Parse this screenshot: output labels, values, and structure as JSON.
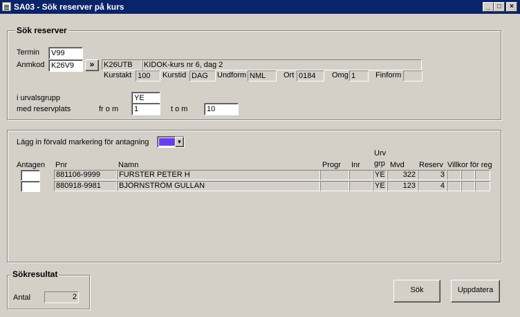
{
  "window": {
    "title": "SA03 - Sök reserver på kurs"
  },
  "search_group": {
    "title": "Sök reserver",
    "termin_label": "Termin",
    "termin_value": "V99",
    "anmkod_label": "Anmkod",
    "anmkod_value": "K26V9",
    "lookup_button": "»",
    "course_code": "K26UTB",
    "course_name": "KIDOK-kurs nr 6, dag 2",
    "kurstakt_label": "Kurstakt",
    "kurstakt_value": "100",
    "kurstid_label": "Kurstid",
    "kurstid_value": "DAG",
    "undform_label": "Undform",
    "undform_value": "NML",
    "ort_label": "Ort",
    "ort_value": "0184",
    "omg_label": "Omg",
    "omg_value": "1",
    "finform_label": "Finform",
    "finform_value": "",
    "urvalsgrupp_label": "i urvalsgrupp",
    "urvalsgrupp_value": "YE",
    "reservplats_label": "med reservplats",
    "from_label": "fr o m",
    "from_value": "1",
    "tom_label": "t o m",
    "tom_value": "10"
  },
  "list_group": {
    "marking_label": "Lägg in förvald markering för antagning",
    "marking_color": "#6a3ef0",
    "headers": {
      "antagen": "Antagen",
      "pnr": "Pnr",
      "namn": "Namn",
      "progr": "Progr",
      "inr": "Inr",
      "urv_top": "Urv",
      "urv_bottom": "grp",
      "mvd": "Mvd",
      "reserv": "Reserv",
      "villkor": "Villkor för reg"
    },
    "rows": [
      {
        "pnr": "881106-9999",
        "namn": "FURSTER PETER H",
        "progr": "",
        "inr": "",
        "urv": "YE",
        "mvd": "322",
        "reserv": "3"
      },
      {
        "pnr": "880918-9981",
        "namn": "BJÖRNSTRÖM GULLAN",
        "progr": "",
        "inr": "",
        "urv": "YE",
        "mvd": "123",
        "reserv": "4"
      }
    ]
  },
  "result_group": {
    "title": "Sökresultat",
    "antal_label": "Antal",
    "antal_value": "2"
  },
  "buttons": {
    "sok": "Sök",
    "uppdatera": "Uppdatera"
  }
}
